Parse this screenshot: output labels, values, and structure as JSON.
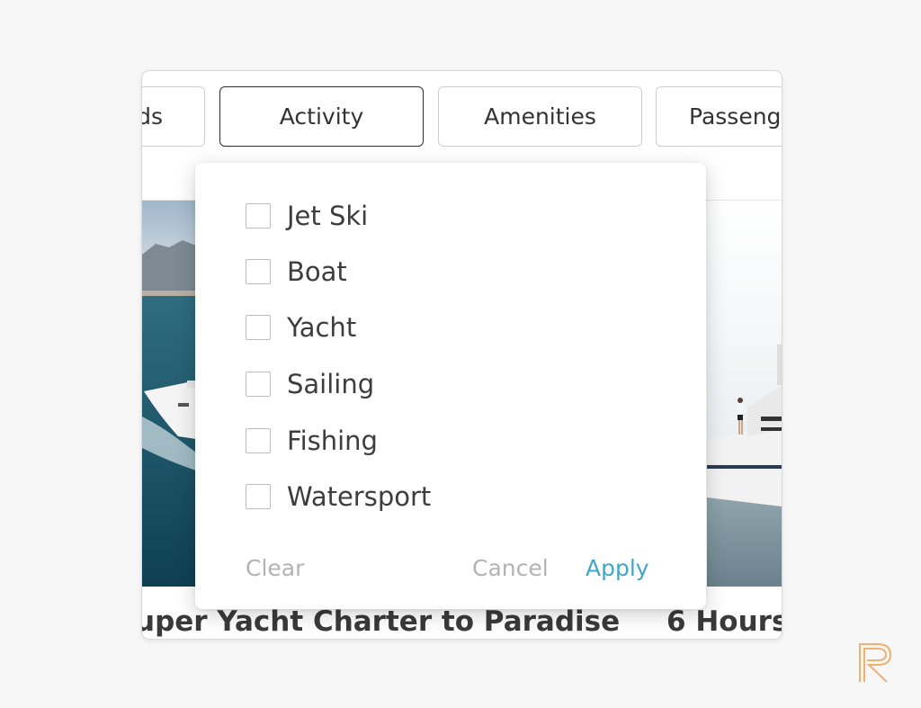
{
  "filters": {
    "chips": [
      {
        "label": "ds"
      },
      {
        "label": "Activity"
      },
      {
        "label": "Amenities"
      },
      {
        "label": "Passeng"
      }
    ]
  },
  "dropdown": {
    "options": [
      {
        "label": "Jet Ski",
        "checked": false
      },
      {
        "label": "Boat",
        "checked": false
      },
      {
        "label": "Yacht",
        "checked": false
      },
      {
        "label": "Sailing",
        "checked": false
      },
      {
        "label": "Fishing",
        "checked": false
      },
      {
        "label": "Watersport",
        "checked": false
      }
    ],
    "clear_label": "Clear",
    "cancel_label": "Cancel",
    "apply_label": "Apply"
  },
  "cards": [
    {
      "title": "uper Yacht Charter to Paradise"
    },
    {
      "title": "6 Hours"
    }
  ],
  "colors": {
    "apply": "#3fa6c9",
    "muted": "#b3b3b3",
    "logo": "#f0b070"
  },
  "icons": {
    "logo": "r-logo-icon",
    "checkbox": "checkbox-icon"
  }
}
